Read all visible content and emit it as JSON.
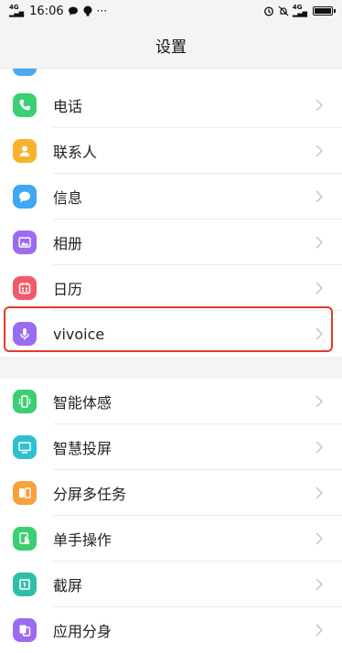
{
  "status_bar": {
    "network_left": "4G",
    "time": "16:06",
    "more": "···",
    "network_right": "4G",
    "battery_level": 0.9
  },
  "header": {
    "title": "设置"
  },
  "settings": {
    "group1": [
      {
        "label": "电话",
        "icon": "phone-icon",
        "color": "#3ccf72"
      },
      {
        "label": "联系人",
        "icon": "contact-icon",
        "color": "#f7b32e"
      },
      {
        "label": "信息",
        "icon": "message-icon",
        "color": "#3fa7f3"
      },
      {
        "label": "相册",
        "icon": "album-icon",
        "color": "#9b6bf2"
      },
      {
        "label": "日历",
        "icon": "calendar-icon",
        "color": "#f25a6a"
      },
      {
        "label": "vivoice",
        "icon": "microphone-icon",
        "color": "#9b6bf2"
      }
    ],
    "group2": [
      {
        "label": "智能体感",
        "icon": "smart-motion-icon",
        "color": "#3ccf72",
        "highlighted": true
      },
      {
        "label": "智慧投屏",
        "icon": "screen-cast-icon",
        "color": "#2fbfd0"
      },
      {
        "label": "分屏多任务",
        "icon": "split-screen-icon",
        "color": "#f7a23a"
      },
      {
        "label": "单手操作",
        "icon": "one-hand-icon",
        "color": "#3ccf72"
      },
      {
        "label": "截屏",
        "icon": "screenshot-icon",
        "color": "#2fbfa8"
      },
      {
        "label": "应用分身",
        "icon": "app-clone-icon",
        "color": "#9b6bf2"
      }
    ]
  },
  "colors": {
    "highlight": "#e43a2b",
    "chevron": "#c4c4c4"
  }
}
